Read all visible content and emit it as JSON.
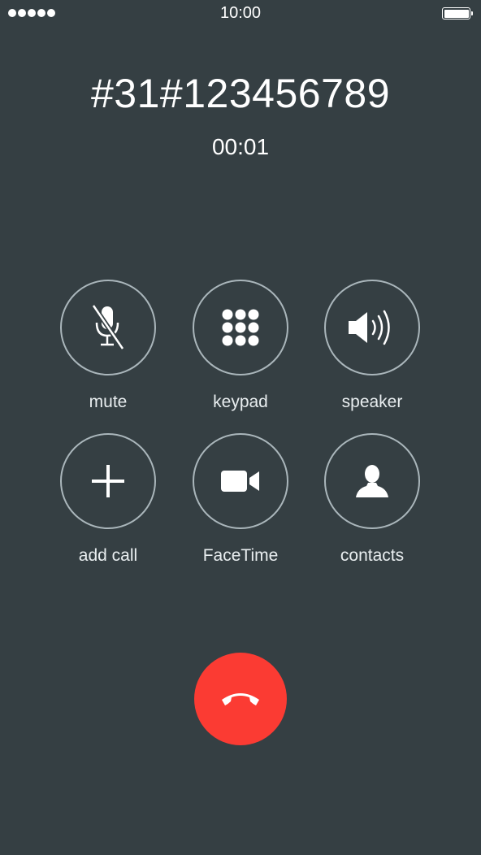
{
  "status_bar": {
    "signal_dots": 5,
    "time": "10:00",
    "battery_percent": 100,
    "signal_icon": "signal-dots-icon",
    "battery_icon": "battery-icon"
  },
  "call": {
    "number": "#31#123456789",
    "duration": "00:01"
  },
  "controls": [
    {
      "label": "mute",
      "icon": "mic-off-icon"
    },
    {
      "label": "keypad",
      "icon": "keypad-icon"
    },
    {
      "label": "speaker",
      "icon": "speaker-icon"
    },
    {
      "label": "add call",
      "icon": "plus-icon"
    },
    {
      "label": "FaceTime",
      "icon": "video-camera-icon"
    },
    {
      "label": "contacts",
      "icon": "contact-person-icon"
    }
  ],
  "end_call": {
    "icon": "end-call-icon",
    "color": "#fb3b33"
  },
  "colors": {
    "background": "#353f43",
    "ring": "#aab6bb",
    "text": "#ffffff"
  }
}
